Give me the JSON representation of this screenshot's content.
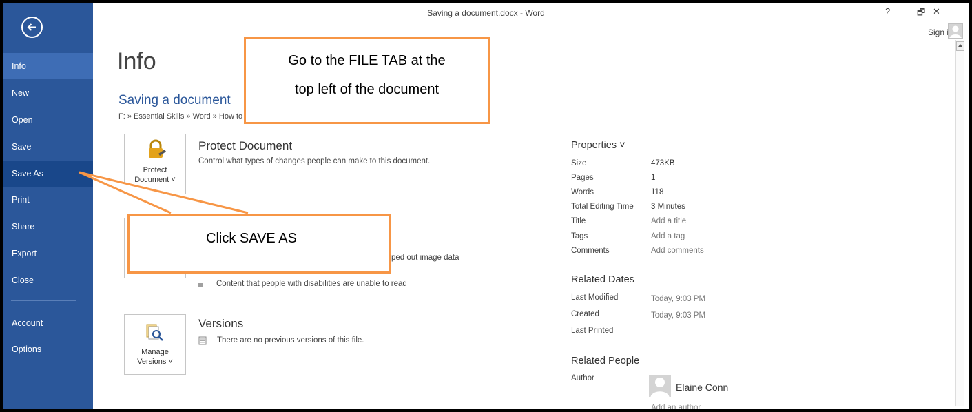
{
  "window": {
    "title": "Saving a document.docx - Word",
    "controls": {
      "help": "?",
      "minimize": "–",
      "restore": "🗗",
      "close": "✕"
    },
    "signin_label": "Sign in"
  },
  "sidebar": {
    "back_icon": "back-arrow-icon",
    "items": [
      {
        "label": "Info",
        "state": "active"
      },
      {
        "label": "New"
      },
      {
        "label": "Open"
      },
      {
        "label": "Save"
      },
      {
        "label": "Save As",
        "state": "selected"
      },
      {
        "label": "Print"
      },
      {
        "label": "Share"
      },
      {
        "label": "Export"
      },
      {
        "label": "Close"
      },
      {
        "label": "Account"
      },
      {
        "label": "Options"
      }
    ],
    "colors": {
      "background": "#2b579a",
      "active": "#3e6db5",
      "selected": "#19478a"
    }
  },
  "info": {
    "heading": "Info",
    "doc_title": "Saving a document",
    "path": "F: » Essential Skills » Word » How to",
    "protect": {
      "button_label_1": "Protect",
      "button_label_2": "Document ˅",
      "title": "Protect Document",
      "description": "Control what types of changes people can make to this document."
    },
    "inspect": {
      "partial_desc": "ped out image data",
      "partial_bullet": "Footers",
      "bullet": "Content that people with disabilities are unable to read"
    },
    "versions": {
      "button_label_1": "Manage",
      "button_label_2": "Versions ˅",
      "title": "Versions",
      "description": "There are no previous versions of this file."
    }
  },
  "properties": {
    "header": "Properties ˅",
    "rows": [
      {
        "key": "Size",
        "value": "473KB"
      },
      {
        "key": "Pages",
        "value": "1"
      },
      {
        "key": "Words",
        "value": "118"
      },
      {
        "key": "Total Editing Time",
        "value": "3 Minutes"
      },
      {
        "key": "Title",
        "value": "Add a title"
      },
      {
        "key": "Tags",
        "value": "Add a tag"
      },
      {
        "key": "Comments",
        "value": "Add comments"
      }
    ],
    "related_dates_header": "Related Dates",
    "dates": [
      {
        "key": "Last Modified",
        "value": "Today, 9:03 PM"
      },
      {
        "key": "Created",
        "value": "Today, 9:03 PM"
      },
      {
        "key": "Last Printed",
        "value": ""
      }
    ],
    "related_people_header": "Related People",
    "author_key": "Author",
    "author_name": "Elaine Conn",
    "add_author": "Add an author"
  },
  "callouts": {
    "file_tab_line1": "Go to the FILE TAB at the",
    "file_tab_line2": "top left of the document",
    "save_as": "Click SAVE AS",
    "color": "#f79646"
  }
}
